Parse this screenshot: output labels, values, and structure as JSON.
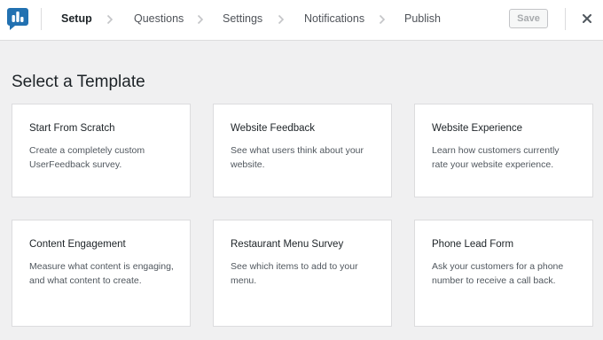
{
  "header": {
    "steps": [
      {
        "label": "Setup",
        "active": true
      },
      {
        "label": "Questions",
        "active": false
      },
      {
        "label": "Settings",
        "active": false
      },
      {
        "label": "Notifications",
        "active": false
      },
      {
        "label": "Publish",
        "active": false
      }
    ],
    "save_label": "Save",
    "close_icon": "close-icon",
    "logo_icon": "userfeedback-logo-icon"
  },
  "colors": {
    "brand": "#2271b1",
    "background": "#f0f0f1",
    "card": "#ffffff",
    "border": "#dcdcde"
  },
  "main": {
    "title": "Select a Template",
    "templates": [
      {
        "title": "Start From Scratch",
        "description": "Create a completely custom UserFeedback survey."
      },
      {
        "title": "Website Feedback",
        "description": "See what users think about your website."
      },
      {
        "title": "Website Experience",
        "description": "Learn how customers currently rate your website experience."
      },
      {
        "title": "Content Engagement",
        "description": "Measure what content is engaging, and what content to create."
      },
      {
        "title": "Restaurant Menu Survey",
        "description": "See which items to add to your menu."
      },
      {
        "title": "Phone Lead Form",
        "description": "Ask your customers for a phone number to receive a call back."
      }
    ]
  }
}
